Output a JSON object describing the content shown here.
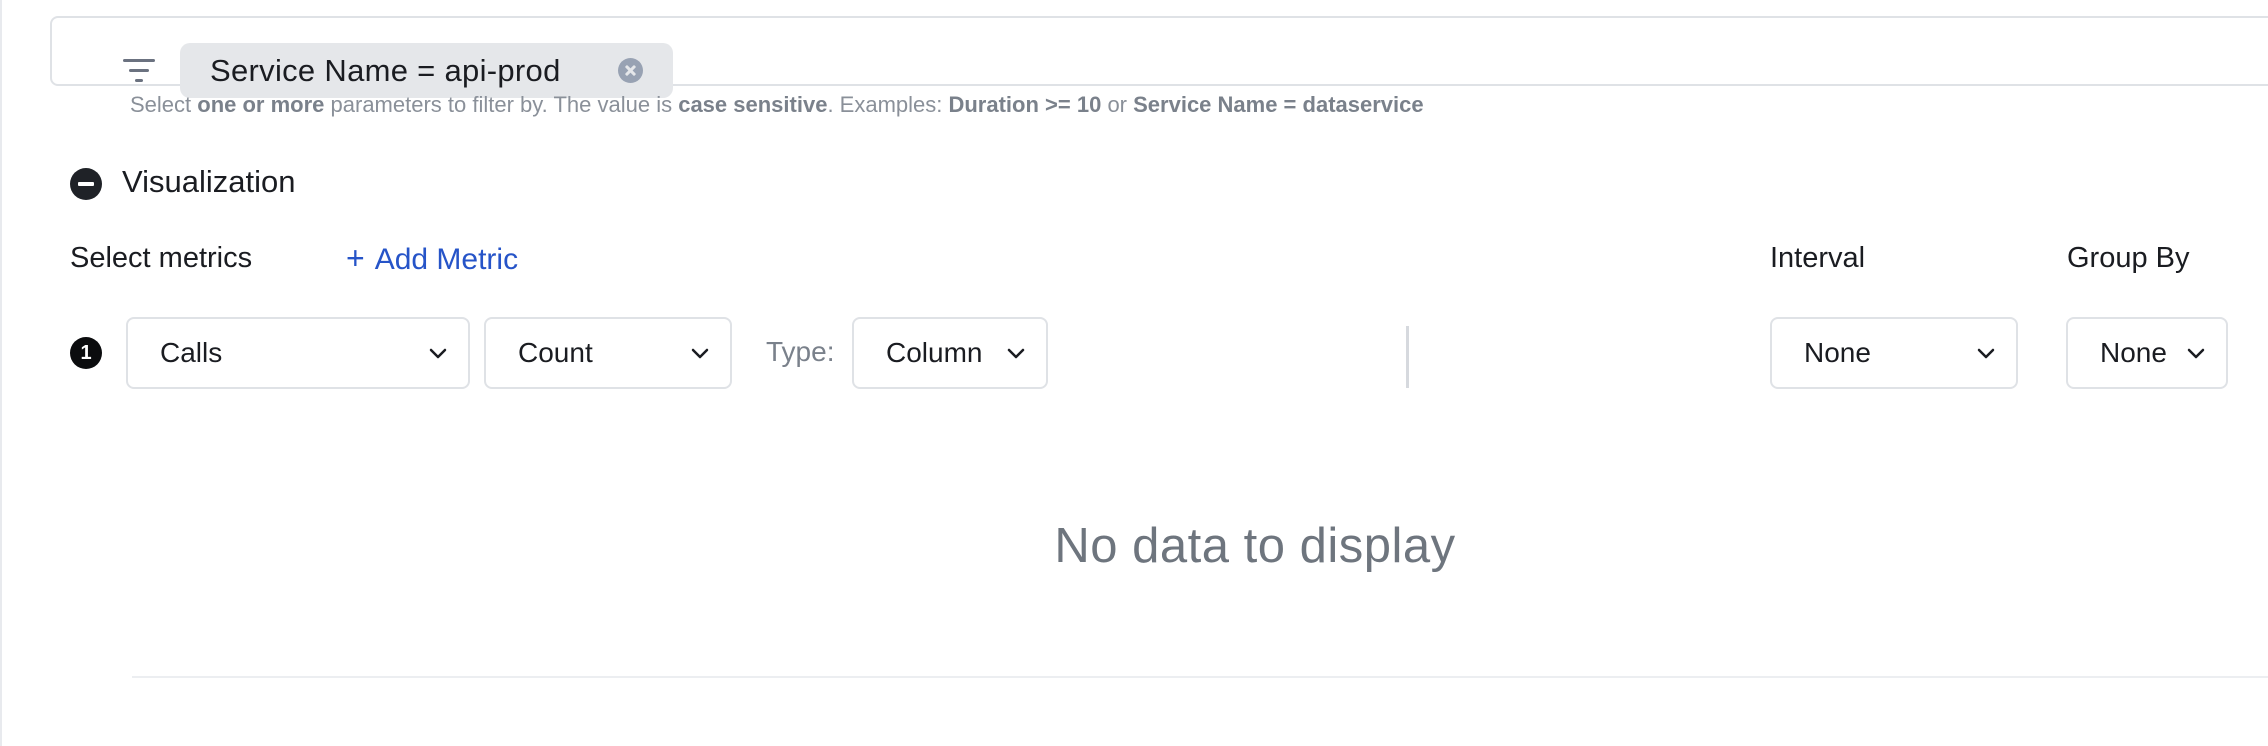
{
  "filter": {
    "chip_label": "Service Name = api-prod"
  },
  "help": {
    "t1": "Select ",
    "b1": "one or more",
    "t2": " parameters to filter by. The value is ",
    "b2": "case sensitive",
    "t3": ". Examples: ",
    "b3": "Duration >= 10",
    "t4": " or ",
    "b4": "Service Name = dataservice"
  },
  "visualization": {
    "title": "Visualization",
    "select_metrics_label": "Select metrics",
    "add_metric_label": "Add Metric",
    "interval_label": "Interval",
    "group_by_label": "Group By",
    "metric_index": "1",
    "metric_value": "Calls",
    "aggregation_value": "Count",
    "type_label": "Type:",
    "type_value": "Column",
    "interval_value": "None",
    "group_by_value": "None",
    "empty_message": "No data to display"
  }
}
